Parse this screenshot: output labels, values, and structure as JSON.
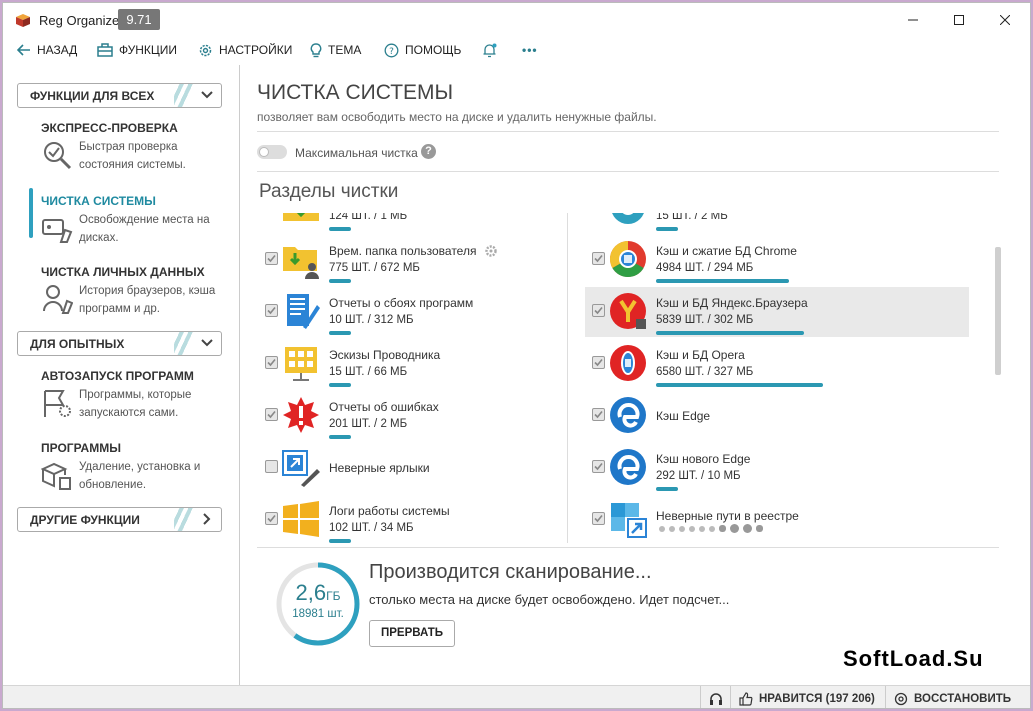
{
  "window": {
    "title": "Reg Organizer",
    "version": "9.71"
  },
  "toolbar": {
    "back": "НАЗАД",
    "functions": "ФУНКЦИИ",
    "settings": "НАСТРОЙКИ",
    "theme": "ТЕМА",
    "help": "ПОМОЩЬ",
    "more": "•••"
  },
  "sidebar": {
    "cat_all": "ФУНКЦИИ ДЛЯ ВСЕХ",
    "cat_advanced": "ДЛЯ ОПЫТНЫХ",
    "cat_other": "ДРУГИЕ ФУНКЦИИ",
    "express": {
      "title": "ЭКСПРЕСС-ПРОВЕРКА",
      "desc": "Быстрая проверка состояния системы."
    },
    "cleanup": {
      "title": "ЧИСТКА СИСТЕМЫ",
      "desc": "Освобождение места на дисках."
    },
    "personal": {
      "title": "ЧИСТКА ЛИЧНЫХ ДАННЫХ",
      "desc": "История браузеров, кэша программ и др."
    },
    "autostart": {
      "title": "АВТОЗАПУСК ПРОГРАММ",
      "desc": "Программы, которые запускаются сами."
    },
    "programs": {
      "title": "ПРОГРАММЫ",
      "desc": "Удаление, установка и обновление."
    }
  },
  "main": {
    "title": "ЧИСТКА СИСТЕМЫ",
    "subtitle": "позволяет вам освободить место на диске и удалить ненужные файлы.",
    "max_clean": "Максимальная чистка",
    "help_mark": "?",
    "sections_title": "Разделы чистки"
  },
  "left_items": [
    {
      "name": "",
      "count": "124 ШТ. / 1 МБ",
      "checked": true,
      "progress": 0.1
    },
    {
      "name": "Врем. папка пользователя",
      "count": "775 ШТ. / 672 МБ",
      "checked": true,
      "progress": 0.1
    },
    {
      "name": "Отчеты о сбоях программ",
      "count": "10 ШТ. / 312 МБ",
      "checked": true,
      "progress": 0.1
    },
    {
      "name": "Эскизы Проводника",
      "count": "15 ШТ. / 66 МБ",
      "checked": true,
      "progress": 0.1
    },
    {
      "name": "Отчеты об ошибках",
      "count": "201 ШТ. / 2 МБ",
      "checked": true,
      "progress": 0.1
    },
    {
      "name": "Неверные ярлыки",
      "count": "",
      "checked": false,
      "progress": 0
    },
    {
      "name": "Логи работы системы",
      "count": "102 ШТ. / 34 МБ",
      "checked": true,
      "progress": 0.1
    }
  ],
  "right_items": [
    {
      "name": "",
      "count": "15 ШТ. / 2 МБ",
      "checked": true,
      "progress": 0.1
    },
    {
      "name": "Кэш и сжатие БД Chrome",
      "count": "4984 ШТ. / 294 МБ",
      "checked": true,
      "progress": 0.72
    },
    {
      "name": "Кэш и БД Яндекс.Браузера",
      "count": "5839 ШТ. / 302 МБ",
      "checked": true,
      "progress": 0.8
    },
    {
      "name": "Кэш и БД Opera",
      "count": "6580 ШТ. / 327 МБ",
      "checked": true,
      "progress": 0.9
    },
    {
      "name": "Кэш Edge",
      "count": "",
      "checked": true,
      "progress": 0
    },
    {
      "name": "Кэш нового Edge",
      "count": "292 ШТ. / 10 МБ",
      "checked": true,
      "progress": 0.1
    },
    {
      "name": "Неверные пути в реестре",
      "count": "",
      "checked": true,
      "progress": 0
    }
  ],
  "scan": {
    "size": "2,6",
    "unit": "ГБ",
    "count": "18981 шт.",
    "title": "Производится сканирование...",
    "subtitle": "столько места на диске будет освобождено. Идет подсчет...",
    "stop": "ПРЕРВАТЬ",
    "progress": 0.6
  },
  "watermark": "SoftLoad.Su",
  "status": {
    "likes": "НРАВИТСЯ (197 206)",
    "restore": "ВОССТАНОВИТЬ"
  },
  "colors": {
    "accent": "#2b98b2",
    "teal_text": "#2b7f8e"
  }
}
